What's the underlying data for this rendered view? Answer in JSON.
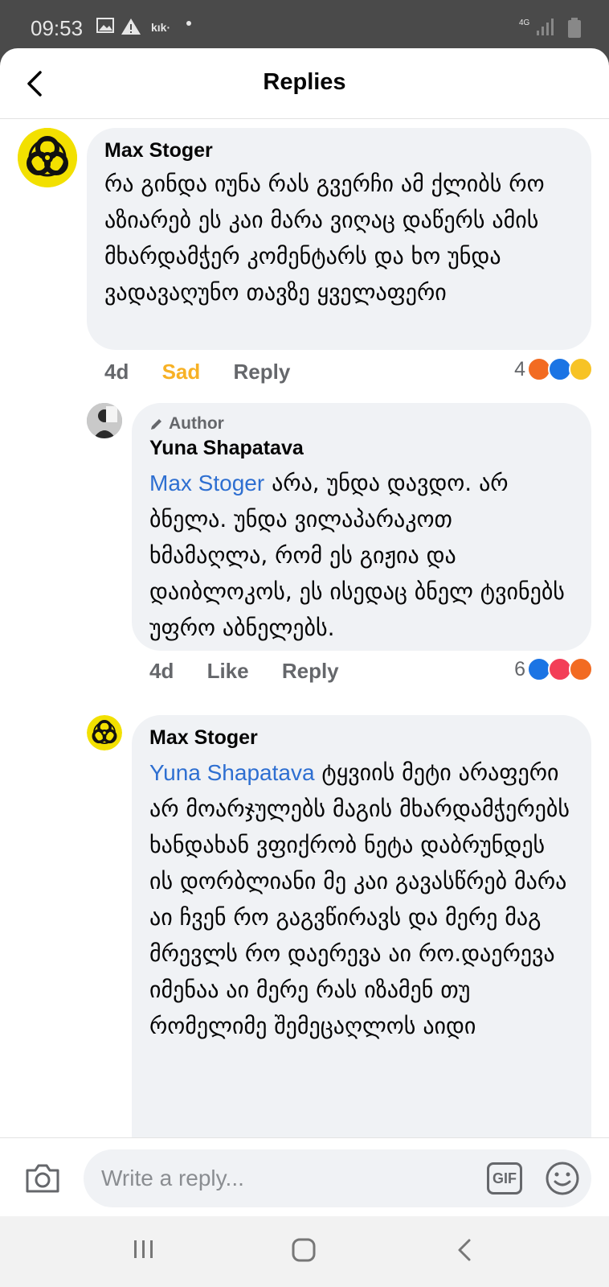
{
  "status_bar": {
    "time": "09:53",
    "carrier_label": "kık·",
    "network": "4G"
  },
  "header": {
    "title": "Replies"
  },
  "comments": [
    {
      "author": "Max Stoger",
      "avatar": "biohazard-avatar",
      "text": "რა გინდა იუნა რას გვერჩი ამ ქლიბს რო აზიარებ ეს კაი მარა ვიღაც დაწერს ამის მხარდამჭერ კომენტარს და ხო უნდა ვადავაღუნო თავზე ყველაფერი",
      "time": "4d",
      "reaction_label": "Sad",
      "reply_label": "Reply",
      "reaction_count": "4",
      "reactions": [
        "angry",
        "like",
        "sad"
      ]
    },
    {
      "author_badge": "Author",
      "author": "Yuna Shapatava",
      "avatar": "person-avatar",
      "mention": "Max Stoger",
      "text": "არა, უნდა დავდო. არ ბნელა. უნდა ვილაპარაკოთ ხმამაღლა, რომ ეს გიჟია და დაიბლოკოს, ეს ისედაც ბნელ ტვინებს უფრო აბნელებს.",
      "time": "4d",
      "like_label": "Like",
      "reply_label": "Reply",
      "reaction_count": "6",
      "reactions": [
        "like",
        "love",
        "angry"
      ]
    },
    {
      "author": "Max Stoger",
      "avatar": "biohazard-avatar",
      "mention": "Yuna Shapatava",
      "text": "ტყვიის მეტი არაფერი არ მოარჯულებს მაგის მხარდამჭერებს ხანდახან ვფიქრობ ნეტა დაბრუნდეს ის დორბლიანი მე კაი გავასწრებ მარა აი ჩვენ რო გაგვწირავს და მერე მაგ მრევლს რო დაერევა აი რო.დაერევა იმენაა აი მერე რას იზამენ თუ რომელიმე შემეცაღლოს აიდი"
    }
  ],
  "reply_bar": {
    "placeholder": "Write a reply...",
    "gif_label": "GIF"
  },
  "colors": {
    "accent": "#2e6fd1",
    "sad": "#f7b125",
    "bubble": "#f0f2f5"
  }
}
